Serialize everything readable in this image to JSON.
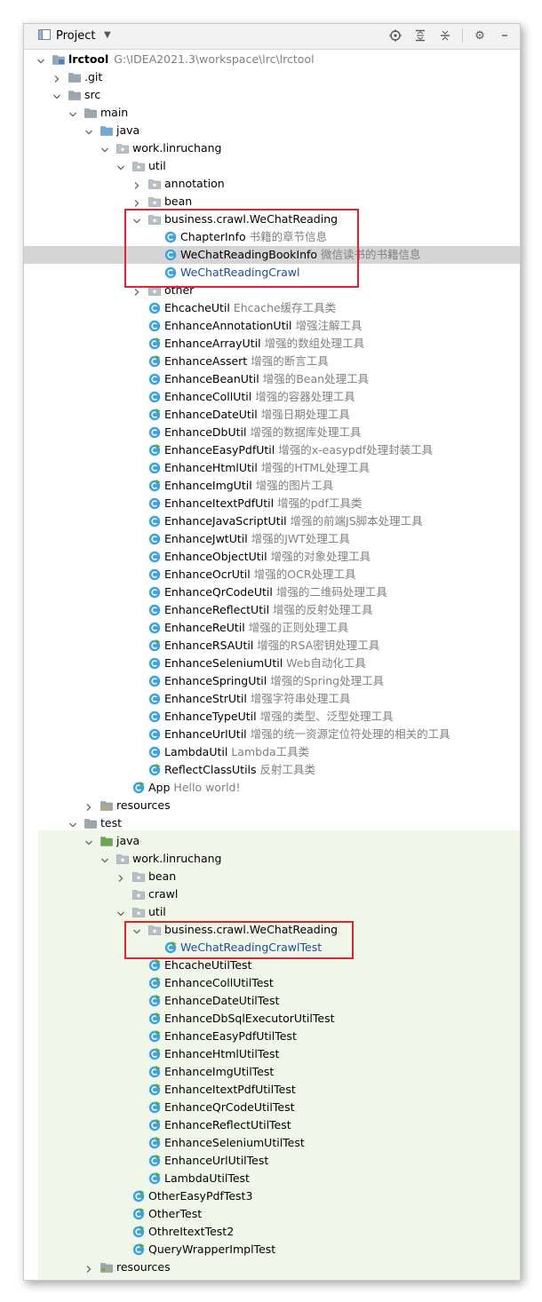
{
  "toolbar": {
    "title": "Project",
    "icons": [
      "project-view-icon",
      "dropdown-icon",
      "locate-icon",
      "expand-all-icon",
      "collapse-all-icon",
      "gear-icon",
      "minimize-icon"
    ]
  },
  "colors": {
    "selection": "#d5d5d5",
    "test_background": "#f0f7e8",
    "highlight_border": "#e0242b",
    "folder": "#9aa7b0",
    "source_folder": "#6fa8dc",
    "test_folder": "#6aa84f",
    "class_icon": "#3aa3e6",
    "runnable_marker": "#55a832",
    "path_text": "#808080",
    "modified_text": "#1a4ea3"
  },
  "tree": [
    {
      "name": "lrctool",
      "desc": "",
      "path": "G:\\IDEA2021.3\\workspace\\lrc\\lrctool",
      "level": 0,
      "type": "module",
      "expanded": true,
      "bold": true
    },
    {
      "name": ".git",
      "desc": "",
      "level": 1,
      "type": "folder",
      "expanded": false
    },
    {
      "name": "src",
      "desc": "",
      "level": 1,
      "type": "folder",
      "expanded": true
    },
    {
      "name": "main",
      "desc": "",
      "level": 2,
      "type": "folder",
      "expanded": true
    },
    {
      "name": "java",
      "desc": "",
      "level": 3,
      "type": "src",
      "expanded": true
    },
    {
      "name": "work.linruchang",
      "desc": "",
      "level": 4,
      "type": "package",
      "expanded": true
    },
    {
      "name": "util",
      "desc": "",
      "level": 5,
      "type": "package",
      "expanded": true
    },
    {
      "name": "annotation",
      "desc": "",
      "level": 6,
      "type": "package",
      "expanded": false
    },
    {
      "name": "bean",
      "desc": "",
      "level": 6,
      "type": "package",
      "expanded": false
    },
    {
      "name": "business.crawl.WeChatReading",
      "desc": "",
      "level": 6,
      "type": "package",
      "expanded": true
    },
    {
      "name": "ChapterInfo",
      "desc": "书籍的章节信息",
      "level": 7,
      "type": "class"
    },
    {
      "name": "WeChatReadingBookInfo",
      "desc": "微信读书的书籍信息",
      "level": 7,
      "type": "class",
      "selected": true
    },
    {
      "name": "WeChatReadingCrawl",
      "desc": "",
      "level": 7,
      "type": "class",
      "blue": true
    },
    {
      "name": "other",
      "desc": "",
      "level": 6,
      "type": "package",
      "expanded": false
    },
    {
      "name": "EhcacheUtil",
      "desc": "Ehcache缓存工具类",
      "level": 6,
      "type": "class"
    },
    {
      "name": "EnhanceAnnotationUtil",
      "desc": "增强注解工具",
      "level": 6,
      "type": "class"
    },
    {
      "name": "EnhanceArrayUtil",
      "desc": "增强的数组处理工具",
      "level": 6,
      "type": "class",
      "runnable": true
    },
    {
      "name": "EnhanceAssert",
      "desc": "增强的断言工具",
      "level": 6,
      "type": "class",
      "runnable": true
    },
    {
      "name": "EnhanceBeanUtil",
      "desc": "增强的Bean处理工具",
      "level": 6,
      "type": "class"
    },
    {
      "name": "EnhanceCollUtil",
      "desc": "增强的容器处理工具",
      "level": 6,
      "type": "class"
    },
    {
      "name": "EnhanceDateUtil",
      "desc": "增强日期处理工具",
      "level": 6,
      "type": "class",
      "runnable": true
    },
    {
      "name": "EnhanceDbUtil",
      "desc": "增强的数据库处理工具",
      "level": 6,
      "type": "class"
    },
    {
      "name": "EnhanceEasyPdfUtil",
      "desc": "增强的x-easypdf处理封装工具",
      "level": 6,
      "type": "class",
      "runnable": true
    },
    {
      "name": "EnhanceHtmlUtil",
      "desc": "增强的HTML处理工具",
      "level": 6,
      "type": "class"
    },
    {
      "name": "EnhanceImgUtil",
      "desc": "增强的图片工具",
      "level": 6,
      "type": "class",
      "runnable": true
    },
    {
      "name": "EnhanceItextPdfUtil",
      "desc": "增强的pdf工具类",
      "level": 6,
      "type": "class"
    },
    {
      "name": "EnhanceJavaScriptUtil",
      "desc": "增强的前端JS脚本处理工具",
      "level": 6,
      "type": "class"
    },
    {
      "name": "EnhanceJwtUtil",
      "desc": "增强的JWT处理工具",
      "level": 6,
      "type": "class"
    },
    {
      "name": "EnhanceObjectUtil",
      "desc": "增强的对象处理工具",
      "level": 6,
      "type": "class"
    },
    {
      "name": "EnhanceOcrUtil",
      "desc": "增强的OCR处理工具",
      "level": 6,
      "type": "class"
    },
    {
      "name": "EnhanceQrCodeUtil",
      "desc": "增强的二维码处理工具",
      "level": 6,
      "type": "class"
    },
    {
      "name": "EnhanceReflectUtil",
      "desc": "增强的反射处理工具",
      "level": 6,
      "type": "class"
    },
    {
      "name": "EnhanceReUtil",
      "desc": "增强的正则处理工具",
      "level": 6,
      "type": "class"
    },
    {
      "name": "EnhanceRSAUtil",
      "desc": "增强的RSA密钥处理工具",
      "level": 6,
      "type": "class",
      "runnable": true
    },
    {
      "name": "EnhanceSeleniumUtil",
      "desc": "Web自动化工具",
      "level": 6,
      "type": "class"
    },
    {
      "name": "EnhanceSpringUtil",
      "desc": "增强的Spring处理工具",
      "level": 6,
      "type": "class"
    },
    {
      "name": "EnhanceStrUtil",
      "desc": "增强字符串处理工具",
      "level": 6,
      "type": "class"
    },
    {
      "name": "EnhanceTypeUtil",
      "desc": "增强的类型、泛型处理工具",
      "level": 6,
      "type": "class"
    },
    {
      "name": "EnhanceUrlUtil",
      "desc": "增强的统一资源定位符处理的相关的工具",
      "level": 6,
      "type": "class"
    },
    {
      "name": "LambdaUtil",
      "desc": "Lambda工具类",
      "level": 6,
      "type": "class"
    },
    {
      "name": "ReflectClassUtils",
      "desc": "反射工具类",
      "level": 6,
      "type": "class",
      "runnable": true
    },
    {
      "name": "App",
      "desc": "Hello world!",
      "level": 5,
      "type": "class",
      "runnable": true
    },
    {
      "name": "resources",
      "desc": "",
      "level": 3,
      "type": "res",
      "expanded": false
    },
    {
      "name": "test",
      "desc": "",
      "level": 2,
      "type": "folder",
      "expanded": true
    },
    {
      "name": "java",
      "desc": "",
      "level": 3,
      "type": "testsrc",
      "expanded": true
    },
    {
      "name": "work.linruchang",
      "desc": "",
      "level": 4,
      "type": "package",
      "expanded": true
    },
    {
      "name": "bean",
      "desc": "",
      "level": 5,
      "type": "package",
      "expanded": false
    },
    {
      "name": "crawl",
      "desc": "",
      "level": 5,
      "type": "package",
      "expanded": null
    },
    {
      "name": "util",
      "desc": "",
      "level": 5,
      "type": "package",
      "expanded": true
    },
    {
      "name": "business.crawl.WeChatReading",
      "desc": "",
      "level": 6,
      "type": "package",
      "expanded": true
    },
    {
      "name": "WeChatReadingCrawlTest",
      "desc": "",
      "level": 7,
      "type": "class",
      "blue": true,
      "runnable": true
    },
    {
      "name": "EhcacheUtilTest",
      "desc": "",
      "level": 6,
      "type": "class",
      "runnable": true
    },
    {
      "name": "EnhanceCollUtilTest",
      "desc": "",
      "level": 6,
      "type": "class",
      "runnable": true
    },
    {
      "name": "EnhanceDateUtilTest",
      "desc": "",
      "level": 6,
      "type": "class",
      "runnable": true
    },
    {
      "name": "EnhanceDbSqlExecutorUtilTest",
      "desc": "",
      "level": 6,
      "type": "class",
      "runnable": true
    },
    {
      "name": "EnhanceEasyPdfUtilTest",
      "desc": "",
      "level": 6,
      "type": "class",
      "runnable": true
    },
    {
      "name": "EnhanceHtmlUtilTest",
      "desc": "",
      "level": 6,
      "type": "class",
      "runnable": true
    },
    {
      "name": "EnhanceImgUtilTest",
      "desc": "",
      "level": 6,
      "type": "class",
      "runnable": true
    },
    {
      "name": "EnhanceItextPdfUtilTest",
      "desc": "",
      "level": 6,
      "type": "class",
      "runnable": true
    },
    {
      "name": "EnhanceQrCodeUtilTest",
      "desc": "",
      "level": 6,
      "type": "class",
      "runnable": true
    },
    {
      "name": "EnhanceReflectUtilTest",
      "desc": "",
      "level": 6,
      "type": "class",
      "runnable": true
    },
    {
      "name": "EnhanceSeleniumUtilTest",
      "desc": "",
      "level": 6,
      "type": "class",
      "runnable": true
    },
    {
      "name": "EnhanceUrlUtilTest",
      "desc": "",
      "level": 6,
      "type": "class",
      "runnable": true
    },
    {
      "name": "LambdaUtilTest",
      "desc": "",
      "level": 6,
      "type": "class",
      "runnable": true
    },
    {
      "name": "OtherEasyPdfTest3",
      "desc": "",
      "level": 5,
      "type": "class",
      "runnable": true
    },
    {
      "name": "OtherTest",
      "desc": "",
      "level": 5,
      "type": "class",
      "runnable": true
    },
    {
      "name": "OthreItextTest2",
      "desc": "",
      "level": 5,
      "type": "class",
      "runnable": true
    },
    {
      "name": "QueryWrapperImplTest",
      "desc": "",
      "level": 5,
      "type": "class",
      "runnable": true
    },
    {
      "name": "resources",
      "desc": "",
      "level": 3,
      "type": "testres",
      "expanded": false
    }
  ]
}
